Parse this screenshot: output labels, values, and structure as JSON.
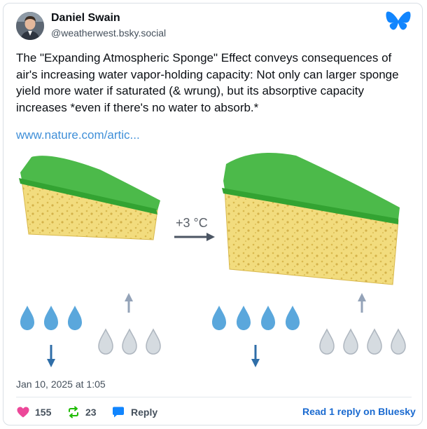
{
  "author": {
    "name": "Daniel Swain",
    "handle": "@weatherwest.bsky.social",
    "avatar_icon": "avatar-photo"
  },
  "post": {
    "text": "The \"Expanding Atmospheric Sponge\" Effect conveys consequences of air's increasing water vapor-holding capacity: Not only can larger sponge yield more water if saturated (& wrung), but its absorptive capacity increases *even if there's no water to absorb.*",
    "link_text": "www.nature.com/artic...",
    "figure_label": "+3 °C",
    "timestamp": "Jan 10, 2025 at 1:05"
  },
  "actions": {
    "likes": "155",
    "reposts": "23",
    "reply_label": "Reply",
    "read_reply_label": "Read 1 reply on Bluesky"
  },
  "colors": {
    "brand": "#1185fe",
    "like": "#ec4899",
    "repost": "#20bc07",
    "reply": "#1185fe",
    "link": "#3f8fd8",
    "sponge_top": "#4cba4a",
    "sponge_body": "#f2dc7e",
    "drop_water": "#5aa7dc",
    "drop_empty": "#d5dbe0",
    "arrow": "#2f6ea8"
  }
}
